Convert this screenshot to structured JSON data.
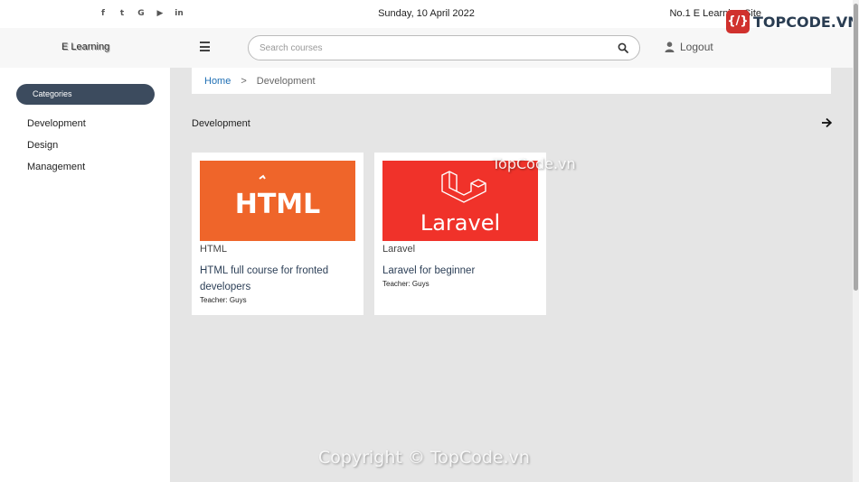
{
  "topbar": {
    "social_icons": [
      {
        "name": "facebook-icon",
        "glyph": "f"
      },
      {
        "name": "twitter-icon",
        "glyph": "t"
      },
      {
        "name": "google-icon",
        "glyph": "G"
      },
      {
        "name": "youtube-icon",
        "glyph": "▶"
      },
      {
        "name": "linkedin-icon",
        "glyph": "in"
      }
    ],
    "date": "Sunday, 10 April 2022",
    "slogan": "No.1 E Learning Site"
  },
  "navbar": {
    "brand": "E Learning",
    "search_placeholder": "Search courses",
    "search_value": "",
    "logout_label": "Logout"
  },
  "sidebar": {
    "categories_label": "Categories",
    "items": [
      "Development",
      "Design",
      "Management"
    ]
  },
  "main": {
    "breadcrumb": {
      "home": "Home",
      "separator": ">",
      "current": "Development"
    },
    "section_title": "Development",
    "courses": [
      {
        "category": "HTML",
        "title": "HTML full course for fronted developers",
        "teacher": "Teacher: Guys",
        "thumb_text": "HTML",
        "thumb_color": "#ef652a"
      },
      {
        "category": "Laravel",
        "title": "Laravel for beginner",
        "teacher": "Teacher: Guys",
        "thumb_text": "Laravel",
        "thumb_color": "#f0322a"
      }
    ]
  },
  "watermarks": {
    "mid": "TopCode.vn",
    "footer": "Copyright © TopCode.vn",
    "logo_badge": "{/}",
    "logo_text": "TOPCODE.VN"
  },
  "colors": {
    "accent_dark": "#3c4b5e",
    "link": "#1f6fb4",
    "main_bg": "#e5e5e5"
  }
}
